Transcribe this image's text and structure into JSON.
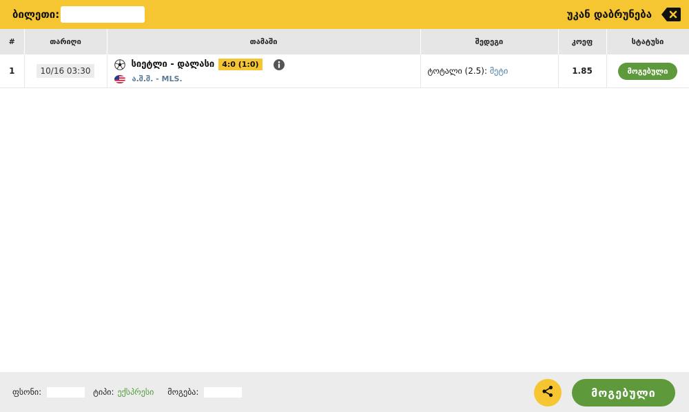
{
  "header": {
    "title": "ბილეთი:",
    "back_label": "უკან დაბრუნება"
  },
  "table": {
    "columns": [
      "#",
      "თარიღი",
      "თამაში",
      "შედეგი",
      "კოეფ",
      "სტატუსი"
    ],
    "rows": [
      {
        "num": "1",
        "date": "10/16 03:30",
        "match": "სიეტლი - დალასი",
        "score": "4:0 (1:0)",
        "league": "ა.შ.შ. - MLS.",
        "market_name": "ტოტალი (2.5):",
        "market_value": "მეტი",
        "odds": "1.85",
        "status": "მოგებული"
      }
    ]
  },
  "footer": {
    "stake_label": "ფსონი:",
    "type_label": "ტიპი:",
    "type_value": "ექსპრესი",
    "win_label": "მოგება:",
    "status_button": "მოგებული"
  },
  "colors": {
    "accent": "#f6c632",
    "success": "#5e9a3b",
    "link": "#4a7aa8"
  },
  "icons": {
    "back": "backspace-icon",
    "sport": "soccer-ball-icon",
    "flag": "usa-flag-icon",
    "info": "info-icon",
    "share": "share-icon"
  }
}
